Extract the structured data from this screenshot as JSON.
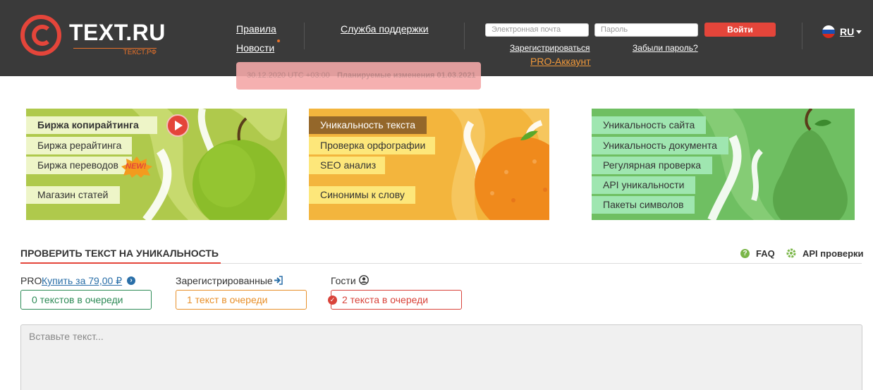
{
  "header": {
    "logo_text": "TEXT.RU",
    "logo_sub": "ТЕКСТ.РФ",
    "nav": {
      "rules": "Правила",
      "news": "Новости",
      "support": "Служба поддержки"
    },
    "email_placeholder": "Электронная почта",
    "password_placeholder": "Пароль",
    "login_button": "Войти",
    "register_link": "Зарегистрироваться",
    "forgot_link": "Забыли пароль?",
    "pro_link": "PRO-Аккаунт",
    "language": "RU"
  },
  "notice": {
    "date": "30.12.2020 UTC +03:00",
    "text": "Планируемые изменения 01.03.2021"
  },
  "banners": {
    "left": [
      "Биржа копирайтинга",
      "Биржа рерайтинга",
      "Биржа переводов",
      "Магазин статей"
    ],
    "new_badge": "NEW!",
    "middle": [
      "Уникальность текста",
      "Проверка орфографии",
      "SEO анализ",
      "Синонимы к слову"
    ],
    "right": [
      "Уникальность сайта",
      "Уникальность документа",
      "Регулярная проверка",
      "API уникальности",
      "Пакеты символов"
    ]
  },
  "check": {
    "title": "ПРОВЕРИТЬ ТЕКСТ НА УНИКАЛЬНОСТЬ",
    "faq": "FAQ",
    "api": "API проверки",
    "pro_label": "PRO",
    "pro_buy": "Купить за 79,00 ₽",
    "registered_label": "Зарегистрированные",
    "guests_label": "Гости",
    "pro_queue": "0 текстов в очереди",
    "registered_queue": "1 текст в очереди",
    "guests_queue": "2 текста в очереди",
    "textarea_placeholder": "Вставьте текст..."
  },
  "colors": {
    "header_bg": "#3a3a3a",
    "accent_red": "#e4453a",
    "accent_orange": "#f29a3a",
    "banner_green": "#a8c84a",
    "banner_orange": "#f2b33d",
    "banner_light_green": "#6fbf62"
  }
}
